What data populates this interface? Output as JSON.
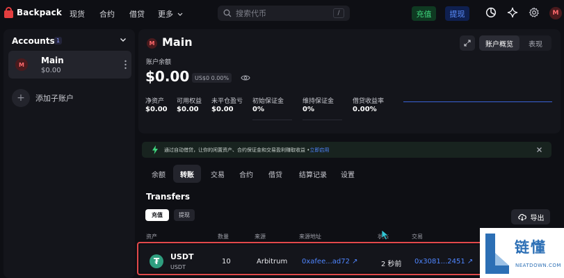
{
  "brand": {
    "name": "Backpack",
    "accent": "#e33e3f"
  },
  "nav": {
    "items": [
      "现货",
      "合约",
      "借贷",
      "更多"
    ],
    "search_placeholder": "搜索代币",
    "search_shortcut": "/",
    "deposit_label": "充值",
    "withdraw_label": "提现",
    "avatar_initial": "M"
  },
  "sidebar": {
    "title": "Accounts",
    "count": "1",
    "account": {
      "initial": "M",
      "name": "Main",
      "balance": "$0.00"
    },
    "add_subaccount_label": "添加子账户"
  },
  "main": {
    "initial": "M",
    "title": "Main",
    "view_tabs": [
      "账户概览",
      "表现"
    ],
    "balance_label": "账户余额",
    "balance_value": "$0.00",
    "balance_chip": "US$0  0.00%",
    "metrics": [
      {
        "label": "净资产",
        "value": "$0.00"
      },
      {
        "label": "可用权益",
        "value": "$0.00"
      },
      {
        "label": "未平仓盈亏",
        "value": "$0.00"
      },
      {
        "label": "初始保证金",
        "value": "0%"
      },
      {
        "label": "维持保证金",
        "value": "0%"
      },
      {
        "label": "借贷收益率",
        "value": "0.00%"
      }
    ]
  },
  "notice": {
    "text": "通过自动借贷，让你的闲置资产、合约保证金和交易盈利赚取收益 •",
    "link": "立即启用"
  },
  "tabs": [
    "余额",
    "转账",
    "交易",
    "合约",
    "借贷",
    "结算记录",
    "设置"
  ],
  "transfers": {
    "title": "Transfers",
    "filters": [
      "充值",
      "提现"
    ],
    "export_label": "导出",
    "columns": [
      "资产",
      "数量",
      "来源",
      "来源地址",
      "状态",
      "交易"
    ],
    "rows": [
      {
        "asset": "USDT",
        "asset_sub": "USDT",
        "quantity": "10",
        "source": "Arbitrum",
        "source_address": "0xafee...ad72 ↗",
        "time": "2 秒前",
        "tx": "0x3081...2451 ↗"
      }
    ]
  },
  "watermark": {
    "title": "链懂",
    "sub": "NEATDOWN.COM"
  }
}
